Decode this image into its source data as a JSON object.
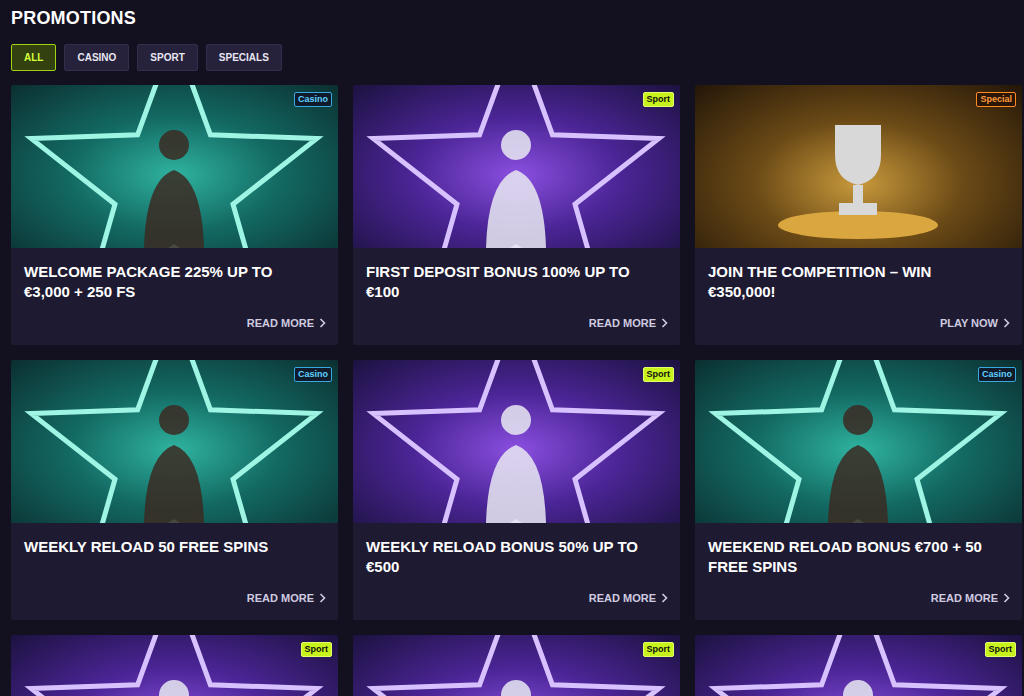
{
  "page": {
    "title": "PROMOTIONS"
  },
  "filters": [
    {
      "label": "ALL",
      "selected": true
    },
    {
      "label": "CASINO",
      "selected": false
    },
    {
      "label": "SPORT",
      "selected": false
    },
    {
      "label": "SPECIALS",
      "selected": false
    }
  ],
  "promotions": [
    {
      "kind": "casino",
      "tag": "Casino",
      "title": "WELCOME PACKAGE 225% UP TO €3,000 + 250 FS",
      "action": "READ MORE"
    },
    {
      "kind": "sport",
      "tag": "Sport",
      "title": "FIRST DEPOSIT BONUS 100% UP TO €100",
      "action": "READ MORE"
    },
    {
      "kind": "special",
      "tag": "Special",
      "title": "JOIN THE COMPETITION – WIN €350,000!",
      "action": "PLAY NOW"
    },
    {
      "kind": "casino",
      "tag": "Casino",
      "title": "WEEKLY RELOAD 50 FREE SPINS",
      "action": "READ MORE"
    },
    {
      "kind": "sport",
      "tag": "Sport",
      "title": "WEEKLY RELOAD BONUS 50% UP TO €500",
      "action": "READ MORE"
    },
    {
      "kind": "casino",
      "tag": "Casino",
      "title": "WEEKEND RELOAD BONUS €700 + 50 FREE SPINS",
      "action": "READ MORE"
    },
    {
      "kind": "sport",
      "tag": "Sport"
    },
    {
      "kind": "sport",
      "tag": "Sport"
    },
    {
      "kind": "sport",
      "tag": "Sport"
    }
  ]
}
